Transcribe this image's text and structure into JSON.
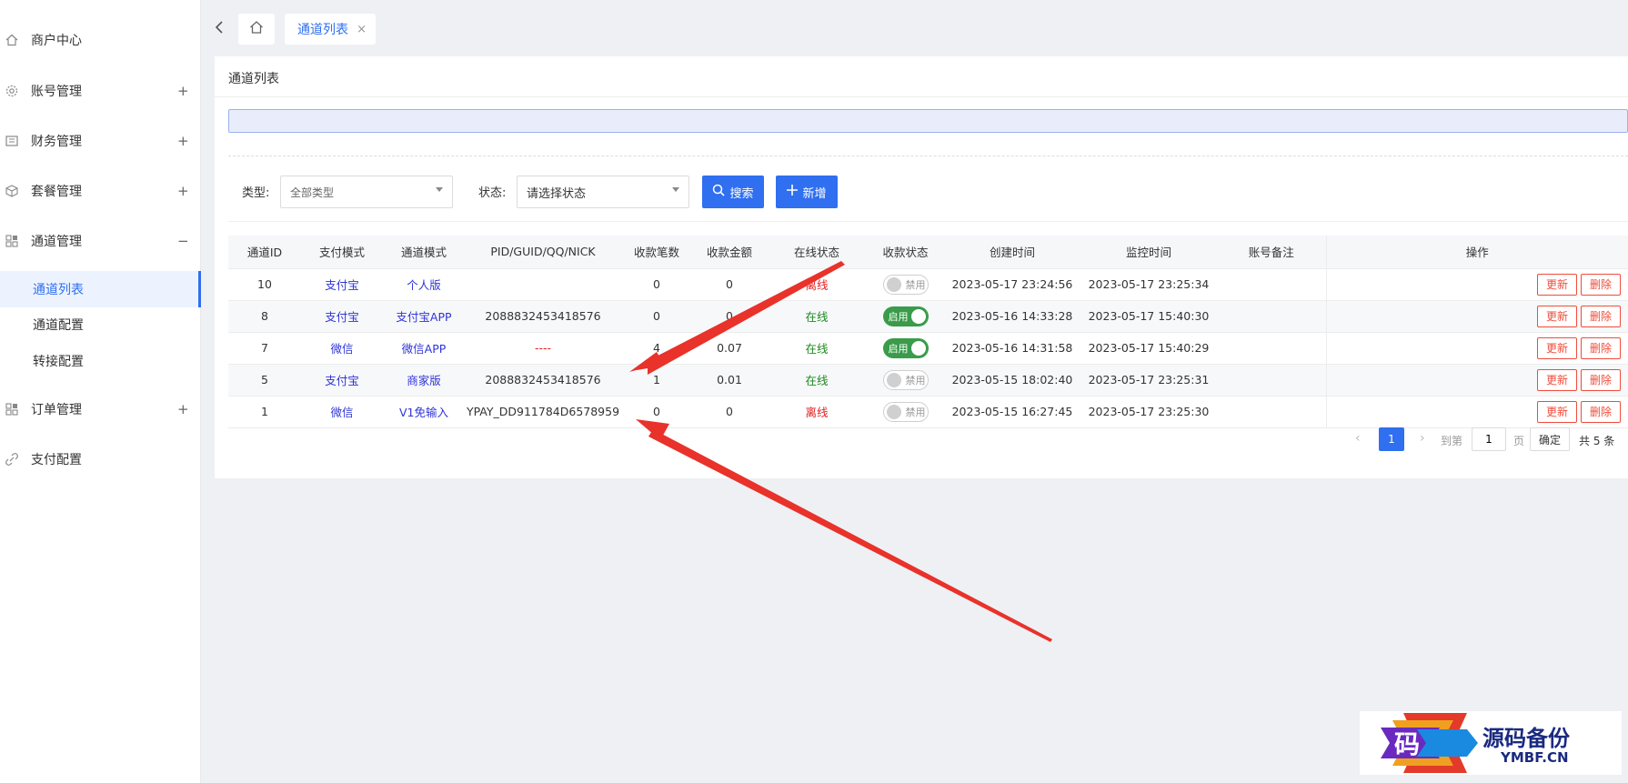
{
  "sidebar": {
    "items": [
      {
        "label": "商户中心",
        "icon": "home-icon"
      },
      {
        "label": "账号管理",
        "icon": "gear-icon",
        "toggle": "+"
      },
      {
        "label": "财务管理",
        "icon": "finance-icon",
        "toggle": "+"
      },
      {
        "label": "套餐管理",
        "icon": "package-icon",
        "toggle": "+"
      },
      {
        "label": "通道管理",
        "icon": "grid-icon",
        "toggle": "−"
      },
      {
        "label": "订单管理",
        "icon": "grid-icon",
        "toggle": "+"
      },
      {
        "label": "支付配置",
        "icon": "link-icon"
      }
    ],
    "sub_items": [
      "通道列表",
      "通道配置",
      "转接配置"
    ]
  },
  "tabs": {
    "active": "通道列表",
    "close": "×"
  },
  "card": {
    "title": "通道列表"
  },
  "filters": {
    "type_label": "类型:",
    "type_value": "全部类型",
    "status_label": "状态:",
    "status_placeholder": "请选择状态",
    "search_btn": "搜索",
    "add_btn": "新增"
  },
  "table": {
    "headers": [
      "通道ID",
      "支付模式",
      "通道模式",
      "PID/GUID/QQ/NICK",
      "收款笔数",
      "收款金额",
      "在线状态",
      "收款状态",
      "创建时间",
      "监控时间",
      "账号备注",
      "操作"
    ],
    "rows": [
      {
        "id": "10",
        "pay_mode": "支付宝",
        "channel_mode": "个人版",
        "pid": "",
        "count": "0",
        "amount": "0",
        "online": "离线",
        "collect": "禁用",
        "created": "2023-05-17 23:24:56",
        "monitor": "2023-05-17 23:25:34",
        "note": ""
      },
      {
        "id": "8",
        "pay_mode": "支付宝",
        "channel_mode": "支付宝APP",
        "pid": "2088832453418576",
        "count": "0",
        "amount": "0",
        "online": "在线",
        "collect": "启用",
        "created": "2023-05-16 14:33:28",
        "monitor": "2023-05-17 15:40:30",
        "note": ""
      },
      {
        "id": "7",
        "pay_mode": "微信",
        "channel_mode": "微信APP",
        "pid": "----",
        "count": "4",
        "amount": "0.07",
        "online": "在线",
        "collect": "启用",
        "created": "2023-05-16 14:31:58",
        "monitor": "2023-05-17 15:40:29",
        "note": ""
      },
      {
        "id": "5",
        "pay_mode": "支付宝",
        "channel_mode": "商家版",
        "pid": "2088832453418576",
        "count": "1",
        "amount": "0.01",
        "online": "在线",
        "collect": "禁用",
        "created": "2023-05-15 18:02:40",
        "monitor": "2023-05-17 23:25:31",
        "note": ""
      },
      {
        "id": "1",
        "pay_mode": "微信",
        "channel_mode": "V1免输入",
        "pid": "YPAY_DD911784D6578959",
        "count": "0",
        "amount": "0",
        "online": "离线",
        "collect": "禁用",
        "created": "2023-05-15 16:27:45",
        "monitor": "2023-05-17 23:25:30",
        "note": ""
      }
    ],
    "action_update": "更新",
    "action_delete": "删除"
  },
  "pagination": {
    "current": "1",
    "goto_label": "到第",
    "goto_value": "1",
    "page_suffix": "页",
    "confirm": "确定",
    "total": "共 5 条"
  },
  "watermark": {
    "logo_char": "码",
    "title": "源码备份",
    "site": "YMBF.CN"
  },
  "colors": {
    "primary": "#2f6ff0",
    "offline": "#e02020",
    "online": "#1a8a1a",
    "switch_on": "#3a9b4a",
    "annotation_arrow": "#e8322a"
  }
}
